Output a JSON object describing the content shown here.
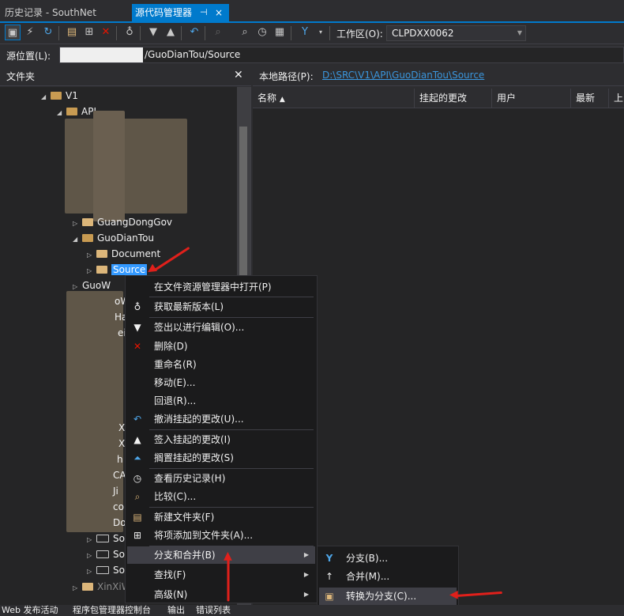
{
  "tabs": {
    "history": "历史记录 - SouthNet",
    "scm": "源代码管理器",
    "scm_pin": "⊣",
    "scm_close": "×"
  },
  "toolbar": {
    "workspace_label": "工作区(O):",
    "workspace_value": "CLPDXX0062"
  },
  "source_location": {
    "label": "源位置(L):",
    "path": "/GuoDianTou/Source"
  },
  "folder_panel": {
    "title": "文件夹",
    "close": "✕",
    "items": [
      {
        "label": "V1"
      },
      {
        "label": "API"
      },
      {
        "label": "GuangDongGov"
      },
      {
        "label": "GuoDianTou"
      },
      {
        "label": "Document"
      },
      {
        "label": "Source"
      },
      {
        "label": "GuoW"
      },
      {
        "label": "oW"
      },
      {
        "label": "Ha"
      },
      {
        "label": "ei"
      },
      {
        "label": "X"
      },
      {
        "label": "X"
      },
      {
        "label": "h"
      },
      {
        "label": "CA"
      },
      {
        "label": "Ji"
      },
      {
        "label": "co"
      },
      {
        "label": "Do"
      },
      {
        "label": "So"
      },
      {
        "label": "So"
      },
      {
        "label": "So"
      },
      {
        "label": "XinXiW"
      }
    ]
  },
  "local_path": {
    "label": "本地路径(P):",
    "value": "D:\\SRC\\V1\\API\\GuoDianTou\\Source"
  },
  "columns": [
    "名称",
    "挂起的更改",
    "用户",
    "最新",
    "上"
  ],
  "context_menu": [
    {
      "label": "在文件资源管理器中打开(P)",
      "icon": "none"
    },
    {
      "label": "获取最新版本(L)",
      "icon": "get-latest-icon"
    },
    {
      "label": "签出以进行编辑(O)...",
      "icon": "checkout-icon"
    },
    {
      "label": "删除(D)",
      "icon": "delete-icon"
    },
    {
      "label": "重命名(R)",
      "icon": "none"
    },
    {
      "label": "移动(E)...",
      "icon": "none"
    },
    {
      "label": "回退(R)...",
      "icon": "none"
    },
    {
      "label": "撤消挂起的更改(U)...",
      "icon": "undo-icon"
    },
    {
      "label": "签入挂起的更改(I)",
      "icon": "checkin-icon"
    },
    {
      "label": "搁置挂起的更改(S)",
      "icon": "shelve-icon"
    },
    {
      "label": "查看历史记录(H)",
      "icon": "history-icon"
    },
    {
      "label": "比较(C)...",
      "icon": "compare-icon"
    },
    {
      "label": "新建文件夹(F)",
      "icon": "new-folder-icon"
    },
    {
      "label": "将项添加到文件夹(A)...",
      "icon": "add-items-icon"
    },
    {
      "label": "分支和合并(B)",
      "icon": "none"
    },
    {
      "label": "查找(F)",
      "icon": "none"
    },
    {
      "label": "高级(N)",
      "icon": "none"
    }
  ],
  "submenu": [
    {
      "label": "分支(B)...",
      "icon": "branch-icon"
    },
    {
      "label": "合并(M)...",
      "icon": "merge-icon"
    },
    {
      "label": "转换为分支(C)...",
      "icon": "convert-to-branch-icon"
    }
  ],
  "statusbar": [
    "Web 发布活动",
    "程序包管理器控制台",
    "输出",
    "错误列表"
  ],
  "colors": {
    "accent": "#007acc",
    "selection": "#3399ff",
    "link": "#3a96dd",
    "annotation": "#e0201b",
    "folder": "#dcb67a"
  }
}
